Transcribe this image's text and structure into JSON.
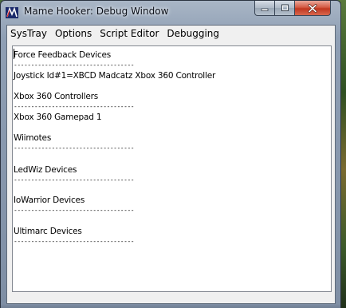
{
  "window": {
    "title": "Mame Hooker:  Debug Window",
    "icon": "mame-hooker-icon",
    "buttons": [
      "minimize-icon",
      "maximize-icon",
      "close-icon"
    ]
  },
  "menu": {
    "items": [
      "SysTray",
      "Options",
      "Script Editor",
      "Debugging"
    ]
  },
  "log": {
    "separator": "-----------------------------------",
    "lines": [
      "Force Feedback Devices",
      "Joystick Id#1=XBCD Madcatz Xbox 360 Controller",
      "Xbox 360 Controllers",
      "Xbox 360  Gamepad 1",
      "Wiimotes",
      "LedWiz Devices",
      "IoWarrior Devices",
      "Ultimarc Devices"
    ]
  }
}
